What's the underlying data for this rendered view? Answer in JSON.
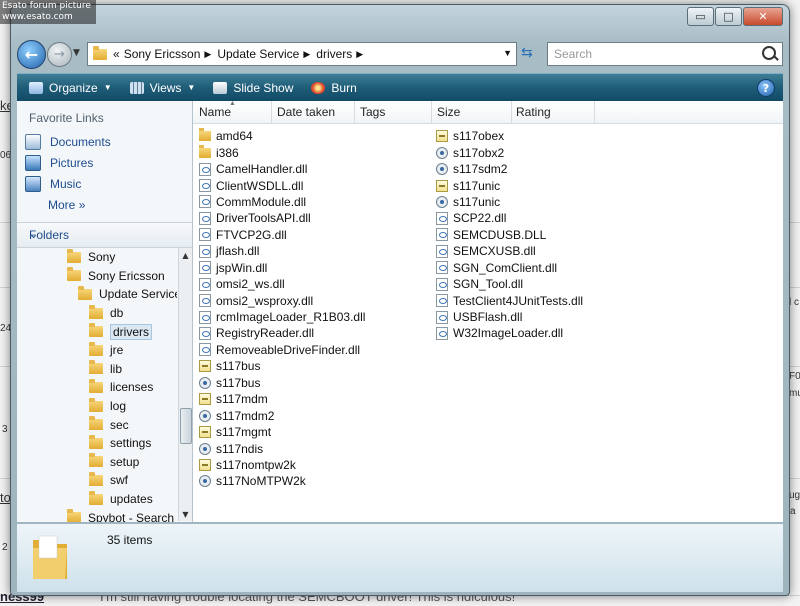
{
  "watermark": {
    "line1": "Esato forum picture",
    "line2": "www.esato.com"
  },
  "background": {
    "fragments": [
      "ke",
      "06",
      "24",
      "3",
      "to",
      "2",
      "l c",
      "F0",
      "mu",
      "ug",
      "a"
    ],
    "username": "ness99",
    "message": "I'm still having trouble locating the SEMCBOOT driver! This is ridiculous!"
  },
  "window": {
    "controls": {
      "minimize": "▭",
      "maximize": "□",
      "close": "✕"
    },
    "address": {
      "breadcrumbs": [
        "Sony Ericsson",
        "Update Service",
        "drivers"
      ],
      "overflow": "«"
    },
    "search": {
      "placeholder": "Search"
    },
    "toolbar": {
      "organize": "Organize",
      "views": "Views",
      "slideshow": "Slide Show",
      "burn": "Burn",
      "help": "?"
    },
    "favorites_header": "Favorite Links",
    "favorites": [
      "Documents",
      "Pictures",
      "Music"
    ],
    "more": "More",
    "folders_header": "Folders",
    "tree": [
      {
        "label": "Sony",
        "level": 0,
        "selected": false
      },
      {
        "label": "Sony Ericsson",
        "level": 0,
        "selected": false
      },
      {
        "label": "Update Service",
        "level": 1,
        "selected": false
      },
      {
        "label": "db",
        "level": 2,
        "selected": false
      },
      {
        "label": "drivers",
        "level": 2,
        "selected": true
      },
      {
        "label": "jre",
        "level": 2,
        "selected": false
      },
      {
        "label": "lib",
        "level": 2,
        "selected": false
      },
      {
        "label": "licenses",
        "level": 2,
        "selected": false
      },
      {
        "label": "log",
        "level": 2,
        "selected": false
      },
      {
        "label": "sec",
        "level": 2,
        "selected": false
      },
      {
        "label": "settings",
        "level": 2,
        "selected": false
      },
      {
        "label": "setup",
        "level": 2,
        "selected": false
      },
      {
        "label": "swf",
        "level": 2,
        "selected": false
      },
      {
        "label": "updates",
        "level": 2,
        "selected": false
      },
      {
        "label": "Spybot - Search &",
        "level": 0,
        "selected": false
      }
    ],
    "columns": [
      "Name",
      "Date taken",
      "Tags",
      "Size",
      "Rating"
    ],
    "files_col1": [
      {
        "name": "amd64",
        "type": "folder"
      },
      {
        "name": "i386",
        "type": "folder"
      },
      {
        "name": "CamelHandler.dll",
        "type": "dll"
      },
      {
        "name": "ClientWSDLL.dll",
        "type": "dll"
      },
      {
        "name": "CommModule.dll",
        "type": "dll"
      },
      {
        "name": "DriverToolsAPI.dll",
        "type": "dll"
      },
      {
        "name": "FTVCP2G.dll",
        "type": "dll"
      },
      {
        "name": "jflash.dll",
        "type": "dll"
      },
      {
        "name": "jspWin.dll",
        "type": "dll"
      },
      {
        "name": "omsi2_ws.dll",
        "type": "dll"
      },
      {
        "name": "omsi2_wsproxy.dll",
        "type": "dll"
      },
      {
        "name": "rcmImageLoader_R1B03.dll",
        "type": "dll"
      },
      {
        "name": "RegistryReader.dll",
        "type": "dll"
      },
      {
        "name": "RemoveableDriveFinder.dll",
        "type": "dll"
      },
      {
        "name": "s117bus",
        "type": "inf"
      },
      {
        "name": "s117bus",
        "type": "cat"
      },
      {
        "name": "s117mdm",
        "type": "inf"
      },
      {
        "name": "s117mdm2",
        "type": "cat"
      },
      {
        "name": "s117mgmt",
        "type": "inf"
      },
      {
        "name": "s117ndis",
        "type": "cat"
      },
      {
        "name": "s117nomtpw2k",
        "type": "inf"
      },
      {
        "name": "s117NoMTPW2k",
        "type": "cat"
      }
    ],
    "files_col2": [
      {
        "name": "s117obex",
        "type": "inf"
      },
      {
        "name": "s117obx2",
        "type": "cat"
      },
      {
        "name": "s117sdm2",
        "type": "cat"
      },
      {
        "name": "s117unic",
        "type": "inf"
      },
      {
        "name": "s117unic",
        "type": "cat"
      },
      {
        "name": "SCP22.dll",
        "type": "dll"
      },
      {
        "name": "SEMCDUSB.DLL",
        "type": "dll"
      },
      {
        "name": "SEMCXUSB.dll",
        "type": "dll"
      },
      {
        "name": "SGN_ComClient.dll",
        "type": "dll"
      },
      {
        "name": "SGN_Tool.dll",
        "type": "dll"
      },
      {
        "name": "TestClient4JUnitTests.dll",
        "type": "dll"
      },
      {
        "name": "USBFlash.dll",
        "type": "dll"
      },
      {
        "name": "W32ImageLoader.dll",
        "type": "dll"
      }
    ],
    "item_count": "35 items"
  }
}
